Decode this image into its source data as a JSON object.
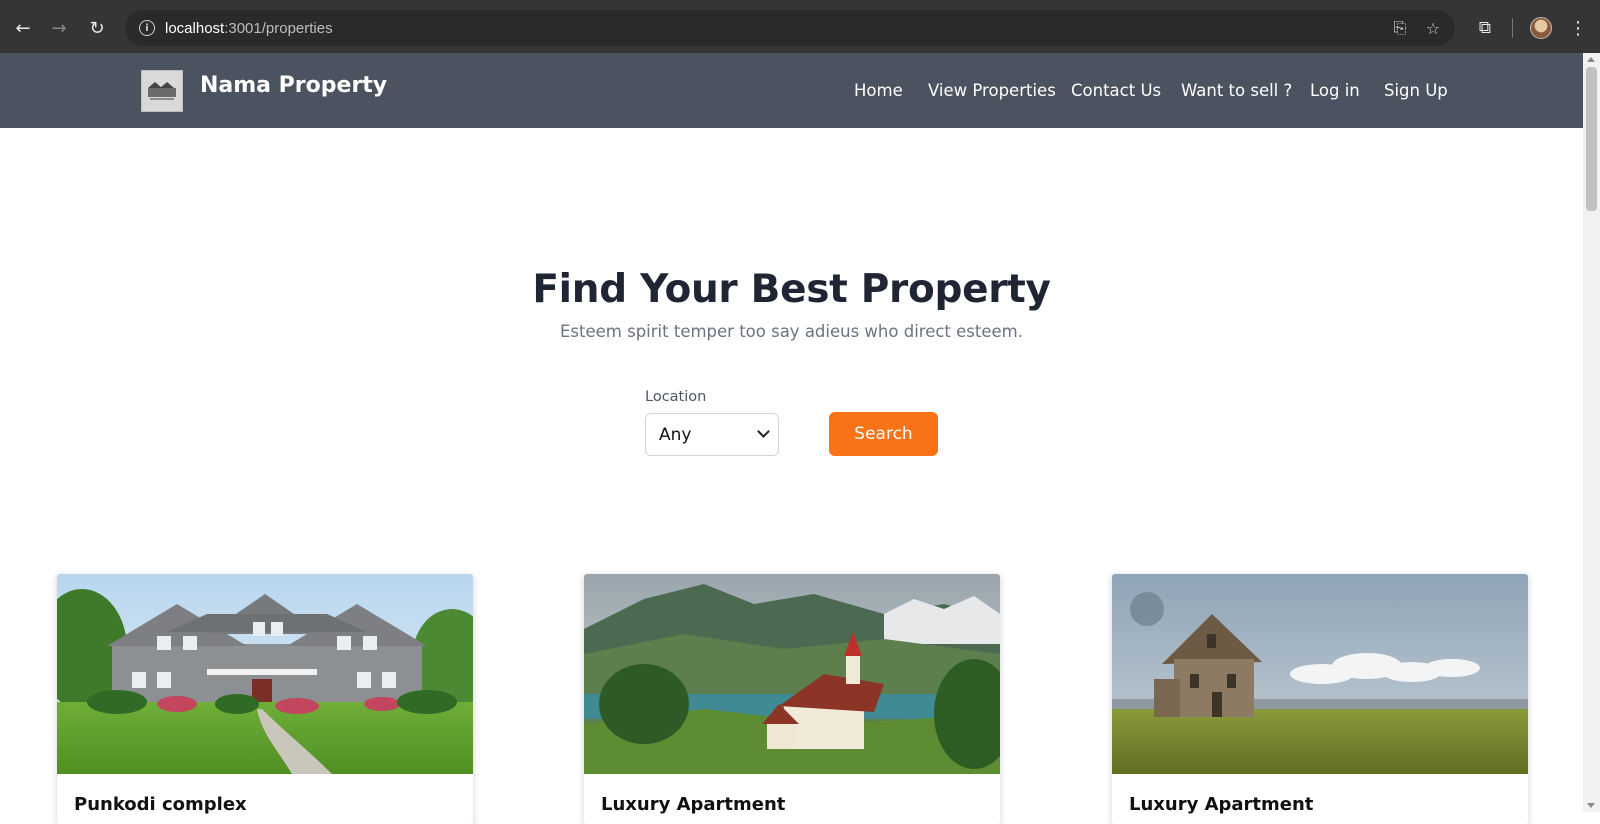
{
  "browser": {
    "url_host": "localhost",
    "url_path": ":3001/properties",
    "back_icon": "back-arrow-icon",
    "forward_icon": "forward-arrow-icon",
    "reload_icon": "reload-icon"
  },
  "navbar": {
    "brand": "Nama Property",
    "links": [
      "Home",
      "View Properties",
      "Contact Us",
      "Want to sell ?",
      "Log in",
      "Sign Up"
    ],
    "bg_color": "#4b5260"
  },
  "hero": {
    "title": "Find Your Best Property",
    "subtitle": "Esteem spirit temper too say adieus who direct esteem."
  },
  "search": {
    "location_label": "Location",
    "location_value": "Any",
    "button_label": "Search",
    "button_color": "#f97316"
  },
  "properties": [
    {
      "title": "Punkodi complex",
      "image": "suburban-house-photo"
    },
    {
      "title": "Luxury Apartment",
      "image": "mountain-lake-chapel-photo"
    },
    {
      "title": "Luxury Apartment",
      "image": "old-farmhouse-field-photo"
    }
  ]
}
